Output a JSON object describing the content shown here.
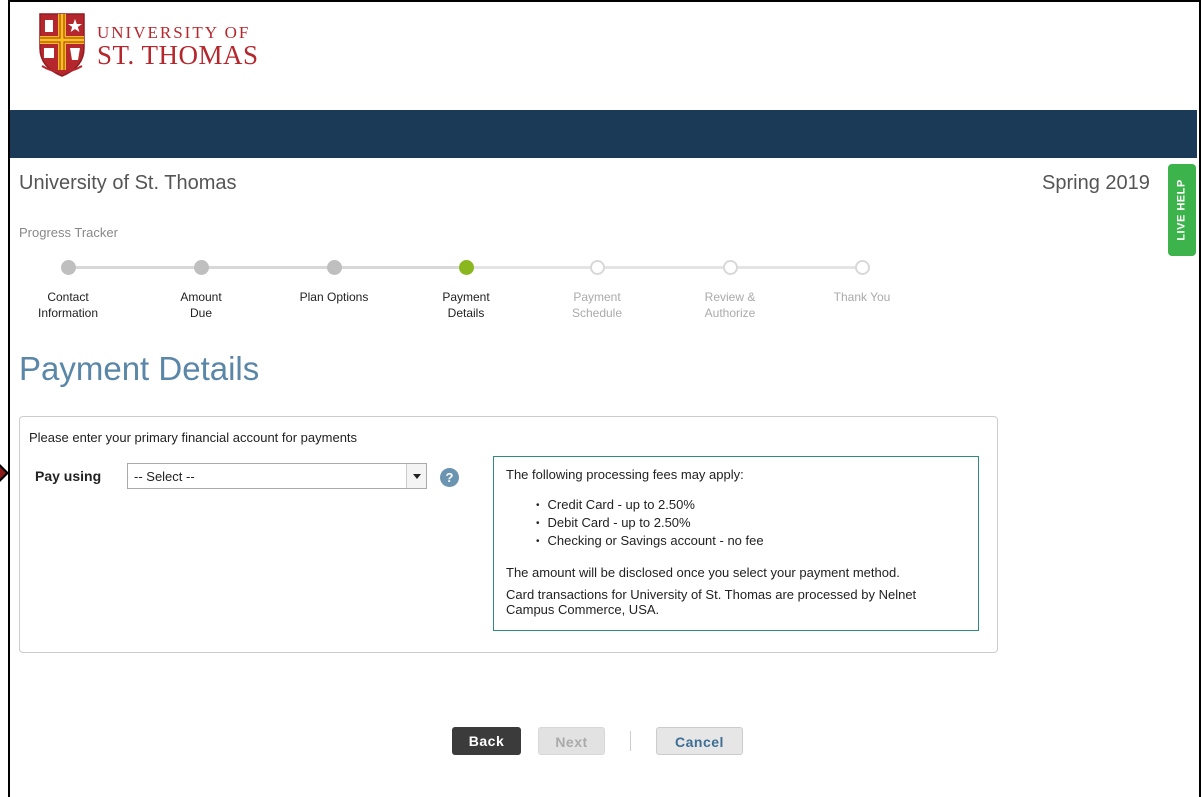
{
  "header": {
    "logo_line1": "UNIVERSITY OF",
    "logo_line2": "ST. THOMAS",
    "colors": {
      "brand_red": "#b5272d",
      "navbar": "#1b3a57"
    }
  },
  "subheader": {
    "school_name": "University of St. Thomas",
    "term": "Spring 2019",
    "live_help_label": "LIVE HELP"
  },
  "tracker": {
    "title": "Progress Tracker",
    "steps": [
      {
        "line1": "Contact",
        "line2": "Information",
        "state": "done"
      },
      {
        "line1": "Amount",
        "line2": "Due",
        "state": "done"
      },
      {
        "line1": "Plan Options",
        "line2": "",
        "state": "done"
      },
      {
        "line1": "Payment",
        "line2": "Details",
        "state": "current"
      },
      {
        "line1": "Payment",
        "line2": "Schedule",
        "state": "future"
      },
      {
        "line1": "Review &",
        "line2": "Authorize",
        "state": "future"
      },
      {
        "line1": "Thank You",
        "line2": "",
        "state": "future"
      }
    ],
    "colors": {
      "current": "#8ab61e",
      "done": "#bfbfbf",
      "future": "#d8d8d8"
    }
  },
  "main": {
    "page_title": "Payment Details",
    "intro": "Please enter your primary financial account for payments",
    "pay_using_label": "Pay using",
    "pay_using_selected": "-- Select --",
    "help_icon_glyph": "?",
    "fees": {
      "title": "The following processing fees may apply:",
      "items": [
        "Credit Card - up to 2.50%",
        "Debit Card - up to 2.50%",
        "Checking or Savings account - no fee"
      ],
      "note": "The amount will be disclosed once you select your payment method.",
      "processor": "Card transactions for University of St. Thomas are processed by Nelnet Campus Commerce, USA."
    }
  },
  "footer": {
    "back_label": "Back",
    "next_label": "Next",
    "cancel_label": "Cancel"
  }
}
